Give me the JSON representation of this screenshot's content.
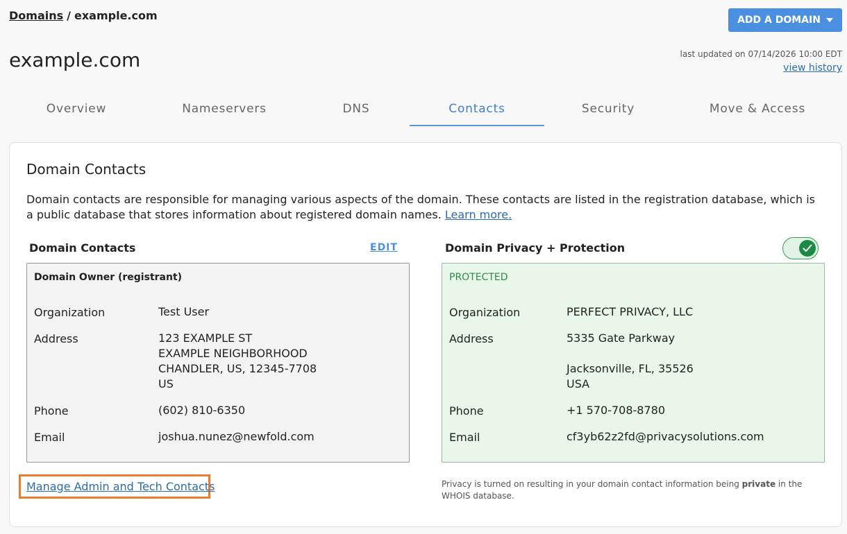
{
  "breadcrumb": {
    "root": "Domains",
    "separator": "/",
    "current": "example.com"
  },
  "header": {
    "add_domain_label": "ADD A DOMAIN",
    "title": "example.com",
    "last_updated": "last updated on 07/14/2026 10:00 EDT",
    "view_history": "view history"
  },
  "tabs": [
    {
      "label": "Overview"
    },
    {
      "label": "Nameservers"
    },
    {
      "label": "DNS"
    },
    {
      "label": "Contacts",
      "active": true
    },
    {
      "label": "Security"
    },
    {
      "label": "Move & Access"
    }
  ],
  "contacts": {
    "section_title": "Domain Contacts",
    "intro": "Domain contacts are responsible for managing various aspects of the domain. These contacts are listed in the registration database, which is a public database that stores information about registered domain names.",
    "learn_more": "Learn more.",
    "left_heading": "Domain Contacts",
    "edit_label": "EDIT",
    "owner": {
      "heading": "Domain Owner (registrant)",
      "labels": {
        "organization": "Organization",
        "address": "Address",
        "phone": "Phone",
        "email": "Email"
      },
      "organization": "Test User",
      "address_lines": [
        "123 EXAMPLE ST",
        "EXAMPLE NEIGHBORHOOD",
        "CHANDLER, US, 12345-7708",
        "US"
      ],
      "phone": "(602) 810-6350",
      "email": "joshua.nunez@newfold.com"
    },
    "manage_link": "Manage Admin and Tech Contacts"
  },
  "privacy": {
    "heading": "Domain Privacy + Protection",
    "toggle_on": true,
    "status": "PROTECTED",
    "labels": {
      "organization": "Organization",
      "address": "Address",
      "phone": "Phone",
      "email": "Email"
    },
    "organization": "PERFECT PRIVACY, LLC",
    "address_lines": [
      "5335 Gate Parkway",
      "",
      "Jacksonville, FL, 35526",
      "USA"
    ],
    "phone": "+1 570-708-8780",
    "email": "cf3yb62z2fd@privacysolutions.com",
    "note_before": "Privacy is turned on resulting in your domain contact information being ",
    "note_bold": "private",
    "note_after": " in the WHOIS database."
  },
  "colors": {
    "accent": "#4a8fe0",
    "link": "#2b6cb0",
    "protected_green": "#2e8b47",
    "highlight_orange": "#f07b2a"
  }
}
